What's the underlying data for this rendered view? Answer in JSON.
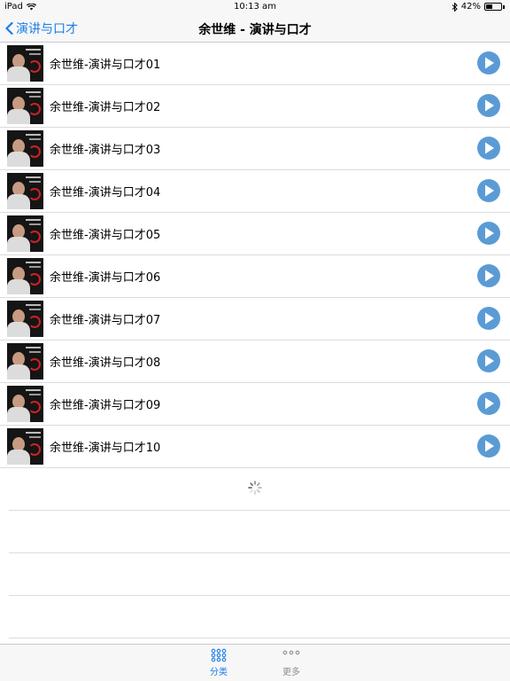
{
  "status_bar": {
    "device": "iPad",
    "time": "10:13 am",
    "battery": "42%",
    "battery_level": 0.42
  },
  "nav": {
    "back_label": "演讲与口才",
    "title": "余世维 - 演讲与口才"
  },
  "items": [
    {
      "label": "余世维-演讲与口才01"
    },
    {
      "label": "余世维-演讲与口才02"
    },
    {
      "label": "余世维-演讲与口才03"
    },
    {
      "label": "余世维-演讲与口才04"
    },
    {
      "label": "余世维-演讲与口才05"
    },
    {
      "label": "余世维-演讲与口才06"
    },
    {
      "label": "余世维-演讲与口才07"
    },
    {
      "label": "余世维-演讲与口才08"
    },
    {
      "label": "余世维-演讲与口才09"
    },
    {
      "label": "余世维-演讲与口才10"
    }
  ],
  "tabs": [
    {
      "label": "分类",
      "icon": "grid-icon",
      "active": true
    },
    {
      "label": "更多",
      "icon": "more-dots-icon",
      "active": false
    }
  ],
  "colors": {
    "accent": "#1a7ee8",
    "play_button": "#5b9bd5",
    "inactive_tab": "#8e8e93"
  }
}
